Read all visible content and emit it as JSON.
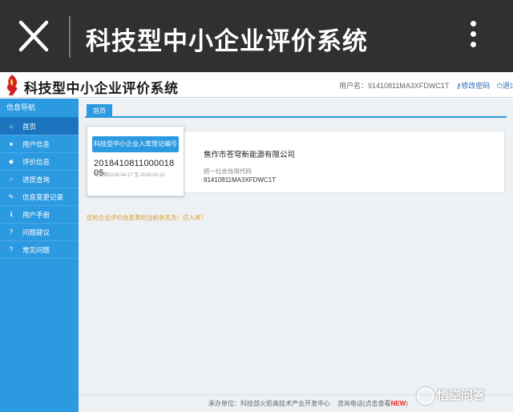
{
  "appbar": {
    "title": "科技型中小企业评价系统"
  },
  "header": {
    "site_title": "科技型中小企业评价系统",
    "username_label": "用户名：",
    "username": "91410811MA3XFDWC1T",
    "change_password": "修改密码",
    "logout": "退出"
  },
  "sidebar": {
    "title": "信息导航",
    "items": [
      {
        "label": "首页",
        "icon": "home-icon",
        "glyph": "⌂"
      },
      {
        "label": "用户信息",
        "icon": "user-icon",
        "glyph": "●"
      },
      {
        "label": "评价信息",
        "icon": "tag-icon",
        "glyph": "◆"
      },
      {
        "label": "进度查询",
        "icon": "search-icon",
        "glyph": "○"
      },
      {
        "label": "信息变更记录",
        "icon": "edit-icon",
        "glyph": "✎"
      },
      {
        "label": "用户手册",
        "icon": "info-icon",
        "glyph": "ℹ"
      },
      {
        "label": "问题建议",
        "icon": "question-icon",
        "glyph": "?"
      },
      {
        "label": "常见问题",
        "icon": "question-icon",
        "glyph": "?"
      }
    ]
  },
  "main": {
    "tab": "首页",
    "card": {
      "button": "科技型中小企业入库登记编号",
      "code": "2018410811000018 05",
      "valid": "有效期2018-04-17 至 2019-03-31"
    },
    "company_name": "焦作市苍穹新能源有限公司",
    "credit_label": "统一社会信用代码",
    "credit_value": "91410811MA3XFDWC1T",
    "status": "您的企业评价信息表的当前状态为：已入库！"
  },
  "footer": {
    "org": "承办单位：科技部火炬高技术产业开发中心",
    "phone": "咨询电话(点击查看",
    "new": "NEW",
    "close": ")"
  },
  "watermark": "悟空问答",
  "colors": {
    "appbar": "#303030",
    "sidebar": "#2c9ae0",
    "sidebar_active": "#1b74bd",
    "status": "#d99a1c"
  }
}
